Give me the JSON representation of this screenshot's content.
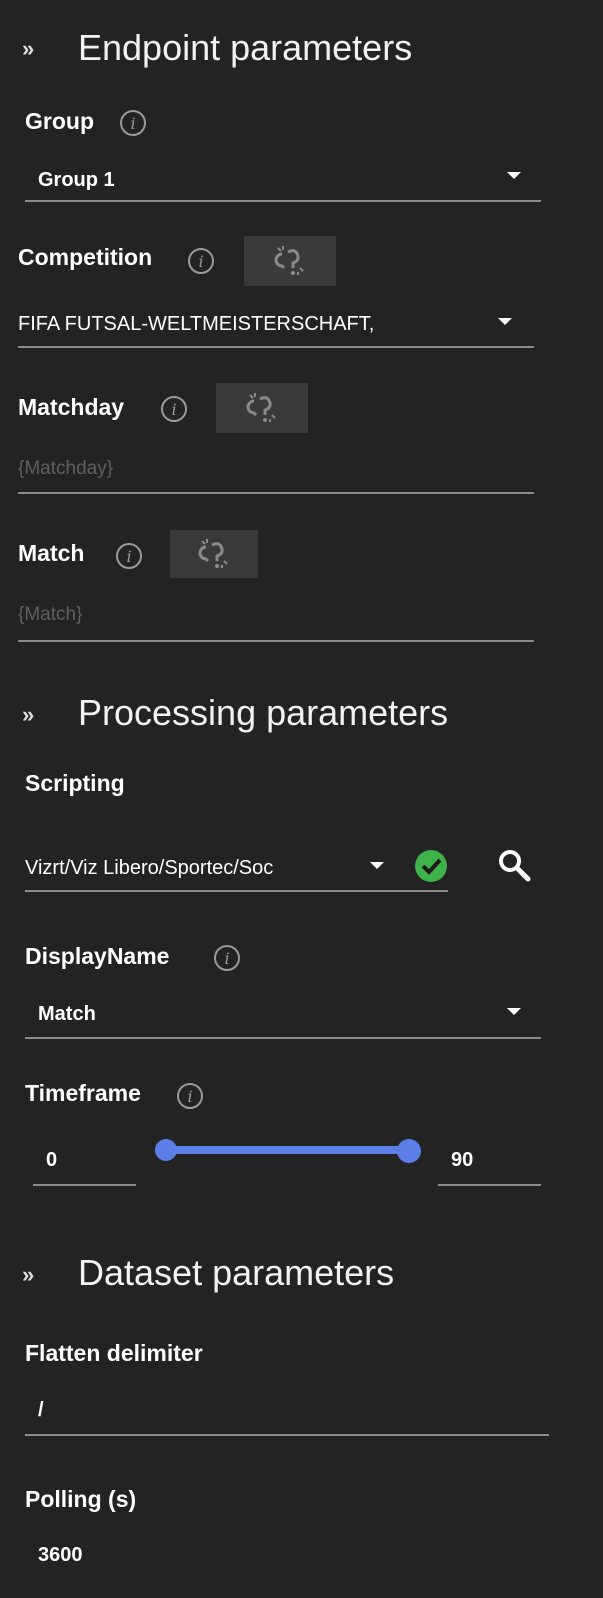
{
  "sections": {
    "endpoint": "Endpoint parameters",
    "processing": "Processing parameters",
    "dataset": "Dataset parameters"
  },
  "group": {
    "label": "Group",
    "value": "Group 1"
  },
  "competition": {
    "label": "Competition",
    "value": "FIFA FUTSAL-WELTMEISTERSCHAFT,"
  },
  "matchday": {
    "label": "Matchday",
    "placeholder": "{Matchday}"
  },
  "match": {
    "label": "Match",
    "placeholder": "{Match}"
  },
  "scripting": {
    "label": "Scripting",
    "value": "Vizrt/Viz Libero/Sportec/Soc"
  },
  "displayname": {
    "label": "DisplayName",
    "value": "Match"
  },
  "timeframe": {
    "label": "Timeframe",
    "min_value": "0",
    "max_value": "90"
  },
  "flatten": {
    "label": "Flatten delimiter",
    "value": "/"
  },
  "polling": {
    "label": "Polling (s)",
    "value": "3600"
  },
  "info_glyph": "i",
  "colors": {
    "accent": "#5b7fe6",
    "success": "#3db34a",
    "background": "#232323",
    "underline": "#8a8a8a"
  },
  "icons": [
    "chevron-down-double-icon",
    "info-icon",
    "unlink-icon",
    "dropdown-caret-icon",
    "check-circle-icon",
    "search-icon"
  ]
}
